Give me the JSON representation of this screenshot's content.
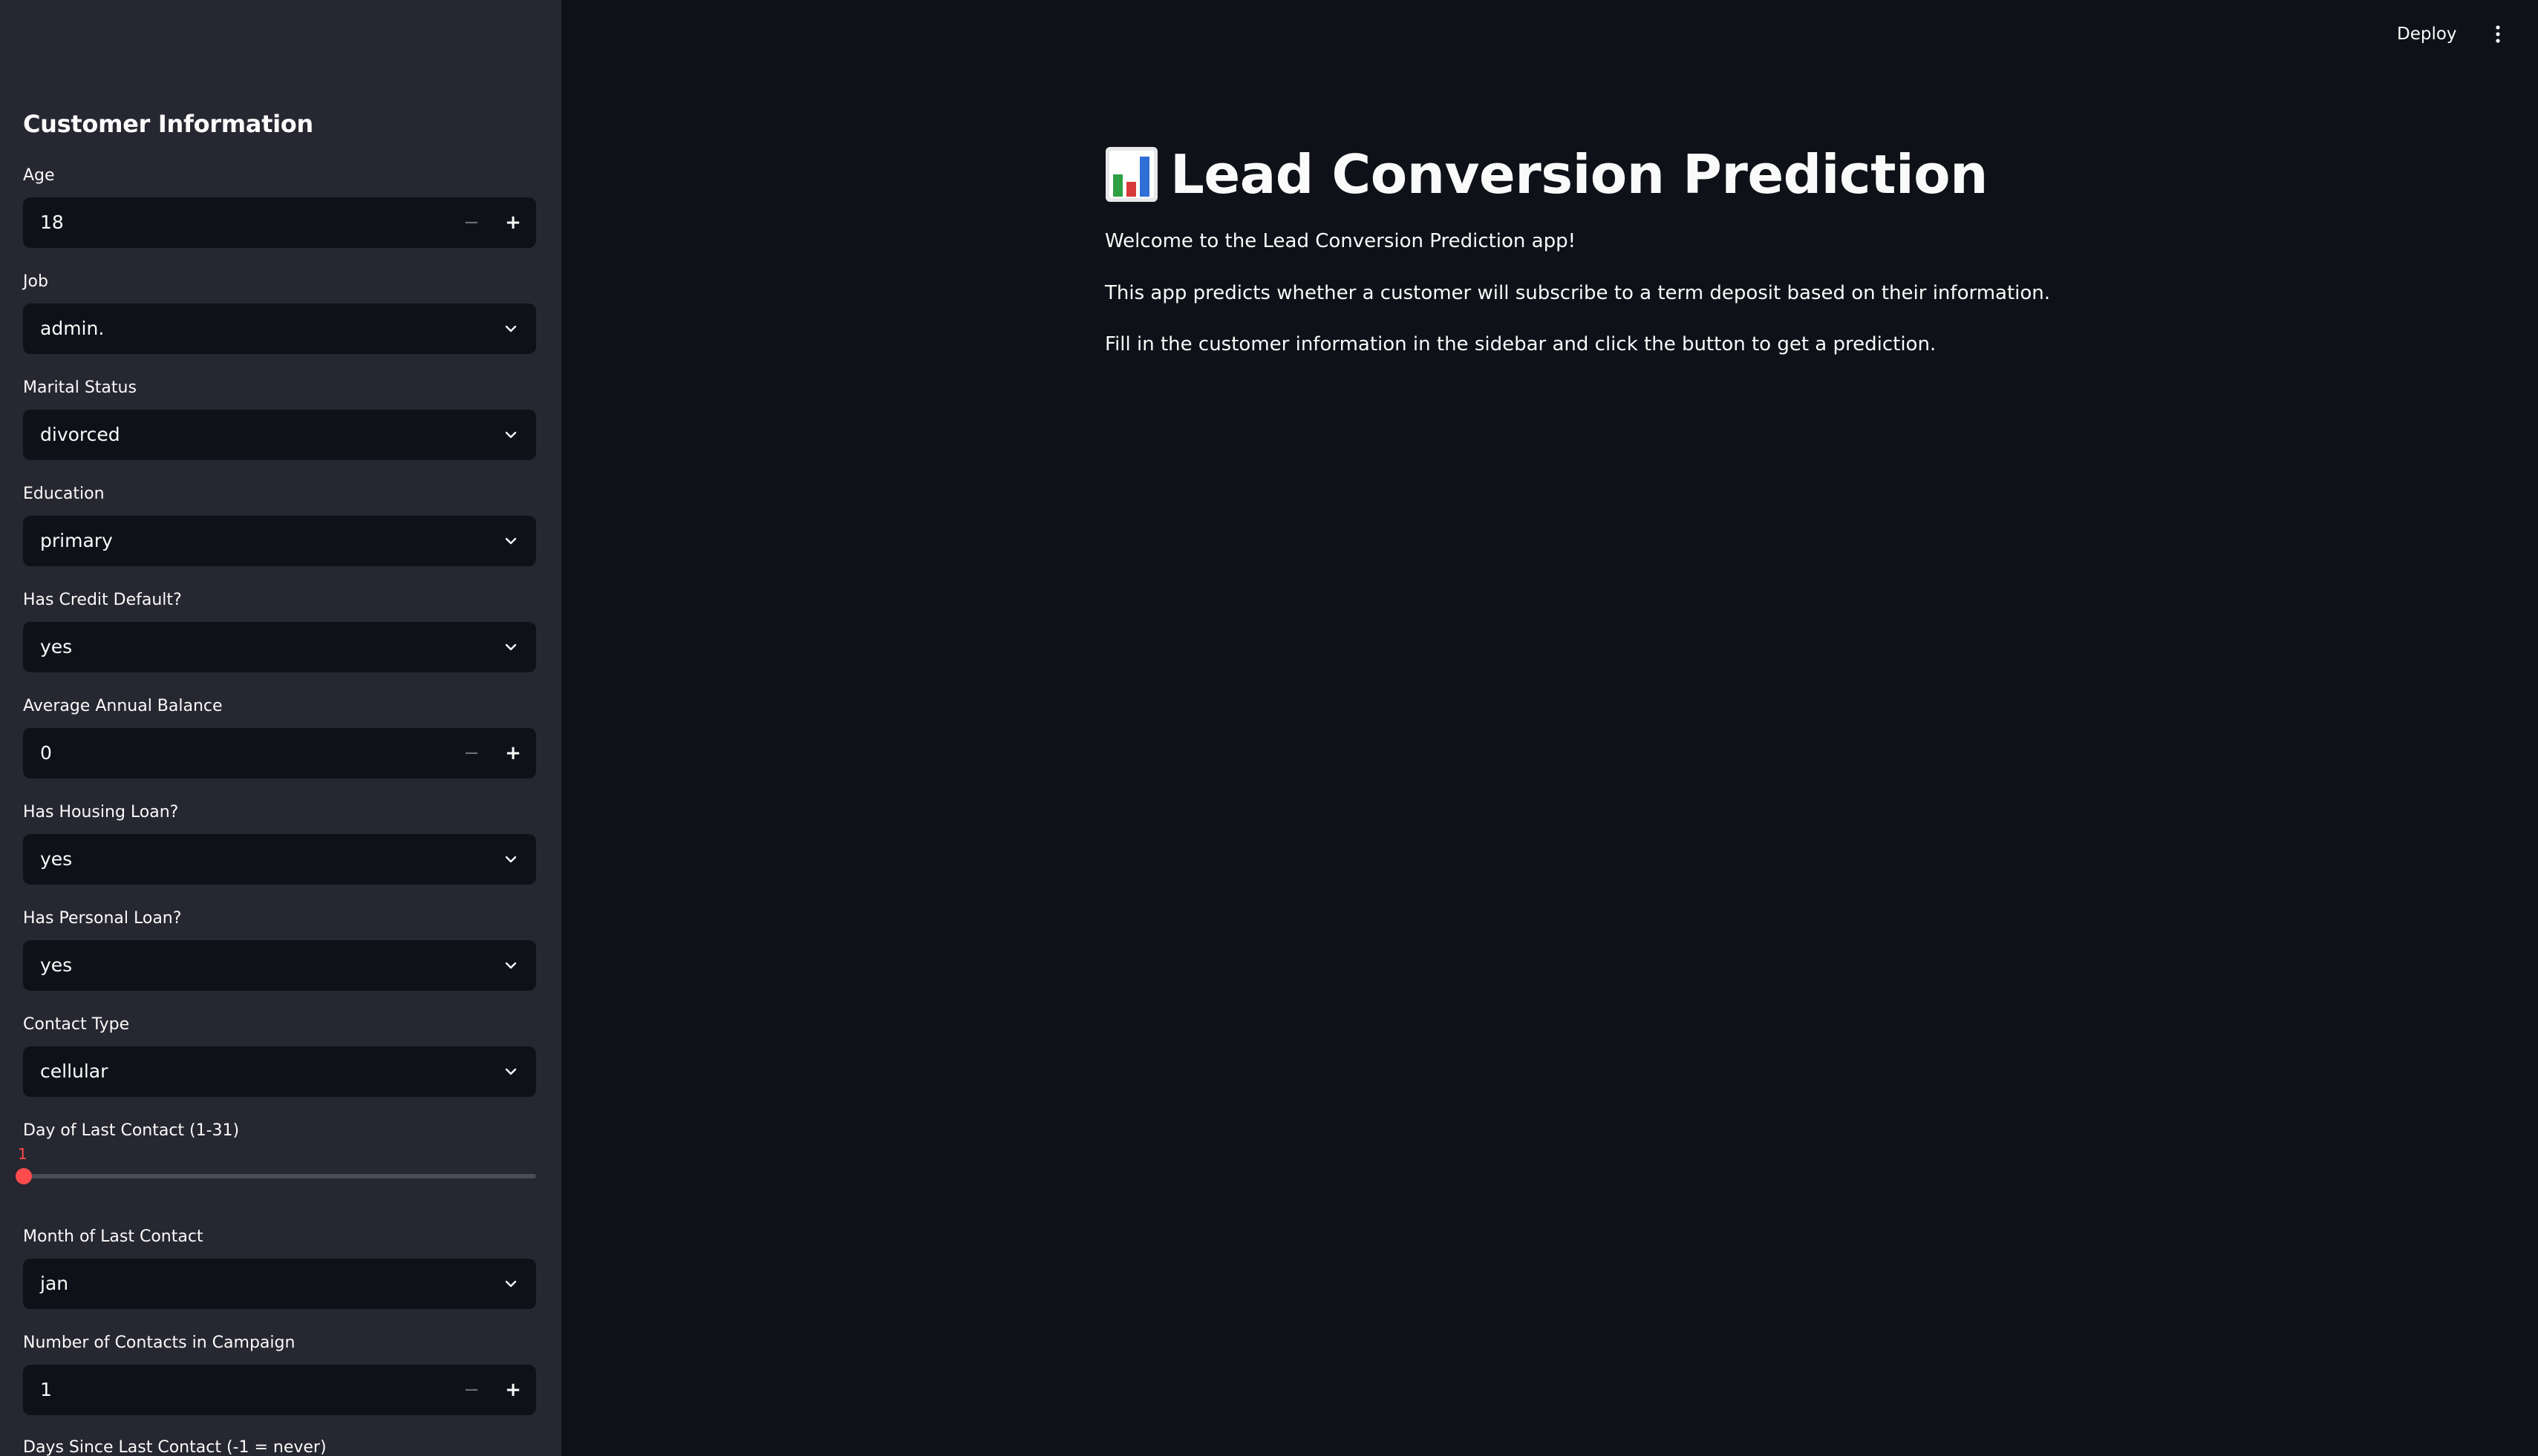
{
  "header": {
    "deploy_label": "Deploy",
    "menu_icon": "kebab-menu-icon"
  },
  "sidebar": {
    "title": "Customer Information",
    "fields": {
      "age": {
        "label": "Age",
        "value": "18"
      },
      "job": {
        "label": "Job",
        "value": "admin."
      },
      "marital": {
        "label": "Marital Status",
        "value": "divorced"
      },
      "education": {
        "label": "Education",
        "value": "primary"
      },
      "credit_default": {
        "label": "Has Credit Default?",
        "value": "yes"
      },
      "balance": {
        "label": "Average Annual Balance",
        "value": "0"
      },
      "housing": {
        "label": "Has Housing Loan?",
        "value": "yes"
      },
      "personal_loan": {
        "label": "Has Personal Loan?",
        "value": "yes"
      },
      "contact": {
        "label": "Contact Type",
        "value": "cellular"
      },
      "day": {
        "label": "Day of Last Contact (1-31)",
        "value": "1",
        "min": 1,
        "max": 31
      },
      "month": {
        "label": "Month of Last Contact",
        "value": "jan"
      },
      "campaign": {
        "label": "Number of Contacts in Campaign",
        "value": "1"
      },
      "pdays": {
        "label": "Days Since Last Contact (-1 = never)"
      }
    },
    "stepper": {
      "minus": "−",
      "plus": "+"
    }
  },
  "main": {
    "title": "Lead Conversion Prediction",
    "title_icon": "bar-chart-icon",
    "welcome": "Welcome to the Lead Conversion Prediction app!",
    "description": "This app predicts whether a customer will subscribe to a term deposit based on their information.",
    "instructions": "Fill in the customer information in the sidebar and click the button to get a prediction."
  },
  "colors": {
    "background": "#0e1117",
    "sidebar": "#262730",
    "accent": "#ff4b4b",
    "text": "#fafafa"
  }
}
